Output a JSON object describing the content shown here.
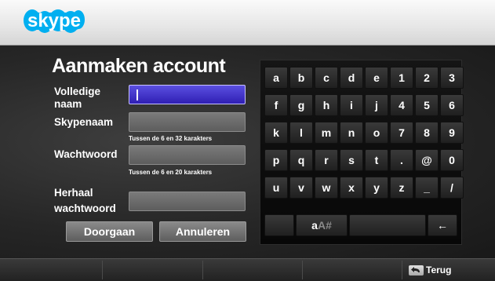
{
  "header": {
    "logo_text": "skype",
    "logo_color": "#00AFF0"
  },
  "form": {
    "title": "Aanmaken account",
    "fields": {
      "full_name": {
        "label_line1": "Volledige",
        "label_line2": "naam",
        "value": ""
      },
      "skype_name": {
        "label": "Skypenaam",
        "value": "",
        "hint": "Tussen de 6 en 32 karakters"
      },
      "password": {
        "label": "Wachtwoord",
        "value": "",
        "hint": "Tussen de 6 en 20 karakters"
      },
      "repeat_password": {
        "label_line1": "Herhaal",
        "label_line2": "wachtwoord",
        "value": ""
      }
    },
    "buttons": {
      "continue": "Doorgaan",
      "cancel": "Annuleren"
    }
  },
  "keyboard": {
    "rows": [
      [
        "a",
        "b",
        "c",
        "d",
        "e",
        "1",
        "2",
        "3"
      ],
      [
        "f",
        "g",
        "h",
        "i",
        "j",
        "4",
        "5",
        "6"
      ],
      [
        "k",
        "l",
        "m",
        "n",
        "o",
        "7",
        "8",
        "9"
      ],
      [
        "p",
        "q",
        "r",
        "s",
        "t",
        ".",
        "@",
        "0"
      ],
      [
        "u",
        "v",
        "w",
        "x",
        "y",
        "z",
        "_",
        "/"
      ]
    ],
    "mode_lower": "a",
    "mode_upper": "A",
    "mode_symbol": "#",
    "backspace": "←"
  },
  "footer": {
    "back_label": "Terug",
    "back_icon": "remote-back-icon"
  }
}
